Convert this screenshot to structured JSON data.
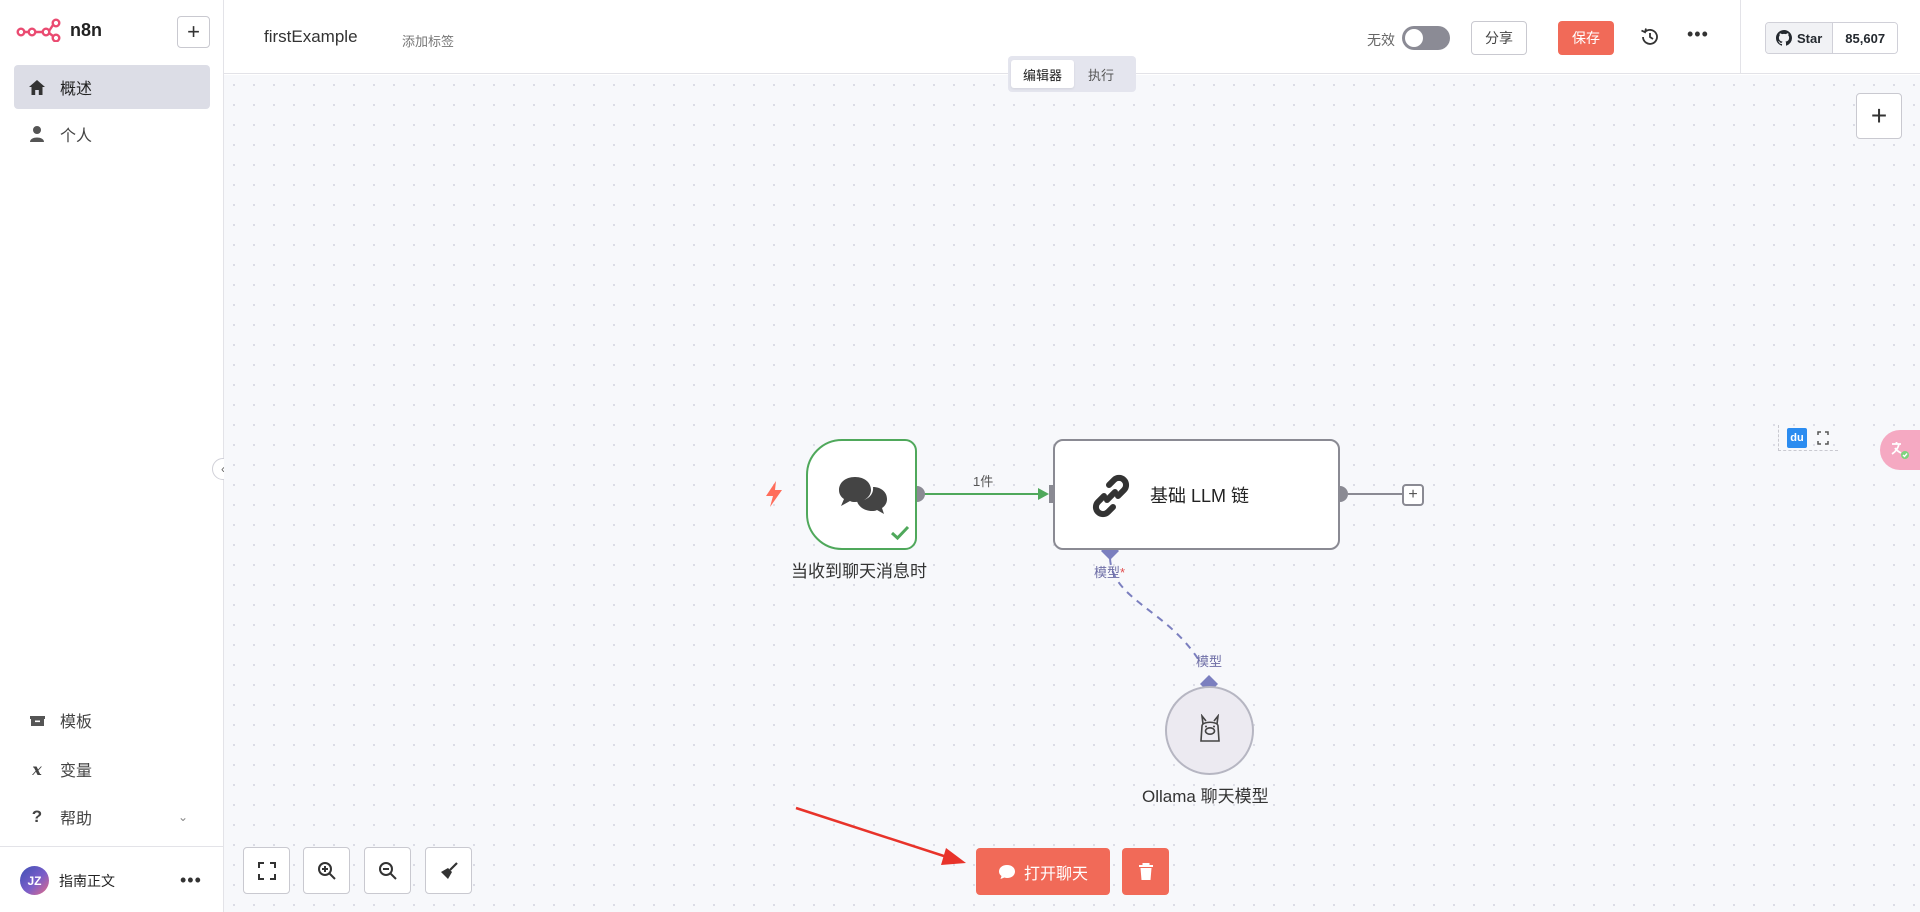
{
  "app": {
    "name": "n8n"
  },
  "sidebar": {
    "items": [
      {
        "label": "概述",
        "icon": "home-icon"
      },
      {
        "label": "个人",
        "icon": "user-icon"
      }
    ],
    "bottom_items": [
      {
        "label": "模板",
        "icon": "box-icon"
      },
      {
        "label": "变量",
        "icon": "variable-icon"
      },
      {
        "label": "帮助",
        "icon": "help-icon"
      }
    ],
    "user": {
      "initials": "JZ",
      "name": "指南正文"
    }
  },
  "header": {
    "workflow_name": "firstExample",
    "add_tag": "添加标签",
    "inactive_label": "无效",
    "share_label": "分享",
    "save_label": "保存",
    "github": {
      "star_label": "Star",
      "star_count": "85,607"
    }
  },
  "tabs": [
    {
      "label": "编辑器",
      "active": true
    },
    {
      "label": "执行",
      "active": false
    }
  ],
  "nodes": {
    "trigger": {
      "label": "当收到聊天消息时"
    },
    "llm": {
      "label": "基础 LLM 链"
    },
    "ollama": {
      "label": "Ollama 聊天模型"
    }
  },
  "edges": {
    "main_count_label": "1件",
    "model_port_label": "模型",
    "model_port_label_2": "模型",
    "required_marker": "*"
  },
  "toolbar": {
    "open_chat_label": "打开聊天"
  },
  "widgets": {
    "du_label": "du"
  },
  "colors": {
    "accent": "#f16a58",
    "success": "#4fa85b",
    "model_port": "#7b7fbf",
    "canvas_bg": "#f7f8fb"
  }
}
